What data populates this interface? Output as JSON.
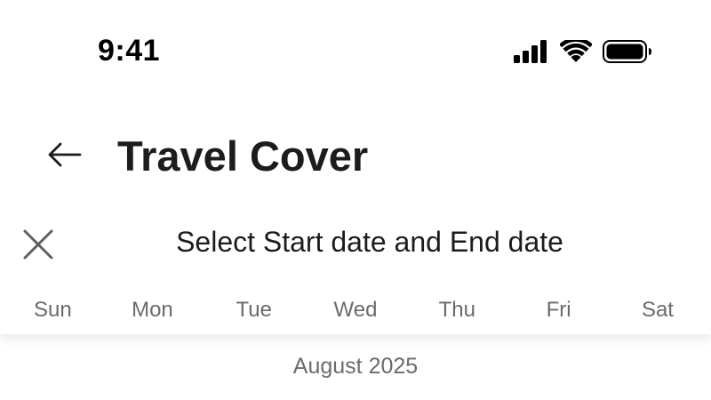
{
  "status_bar": {
    "time": "9:41",
    "icons": [
      "cellular-signal-icon",
      "wifi-icon",
      "battery-icon"
    ]
  },
  "header": {
    "back_icon": "arrow-left-icon",
    "title": "Travel Cover"
  },
  "date_picker": {
    "close_icon": "close-icon",
    "title": "Select Start date and End date",
    "weekdays": [
      "Sun",
      "Mon",
      "Tue",
      "Wed",
      "Thu",
      "Fri",
      "Sat"
    ],
    "month": "August 2025"
  },
  "colors": {
    "text_primary": "#1c1c1c",
    "text_secondary": "#6b6b6b",
    "background": "#ffffff"
  }
}
